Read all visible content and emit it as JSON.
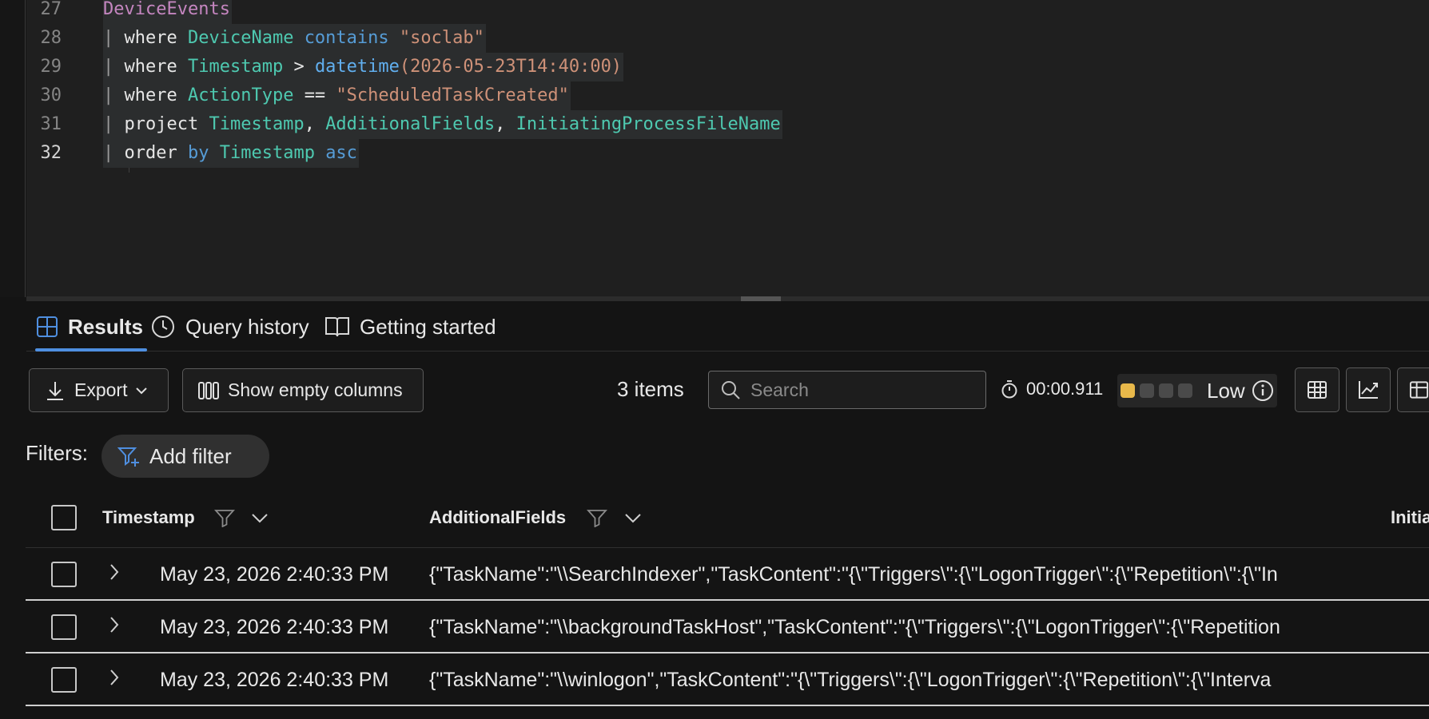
{
  "editor": {
    "lines": [
      {
        "num": "27",
        "tokens": [
          {
            "t": "DeviceEvents",
            "c": "k-purple"
          }
        ]
      },
      {
        "num": "28",
        "tokens": [
          {
            "t": "| ",
            "c": "bar"
          },
          {
            "t": "where ",
            "c": "k-white"
          },
          {
            "t": "DeviceName ",
            "c": "k-teal"
          },
          {
            "t": "contains ",
            "c": "k-blue"
          },
          {
            "t": "\"soclab\"",
            "c": "k-str"
          }
        ]
      },
      {
        "num": "29",
        "tokens": [
          {
            "t": "| ",
            "c": "bar"
          },
          {
            "t": "where ",
            "c": "k-white"
          },
          {
            "t": "Timestamp ",
            "c": "k-teal"
          },
          {
            "t": "> ",
            "c": "k-white"
          },
          {
            "t": "datetime",
            "c": "k-fn"
          },
          {
            "t": "(2026-05-23T14:40:00)",
            "c": "k-str"
          }
        ]
      },
      {
        "num": "30",
        "tokens": [
          {
            "t": "| ",
            "c": "bar"
          },
          {
            "t": "where ",
            "c": "k-white"
          },
          {
            "t": "ActionType ",
            "c": "k-teal"
          },
          {
            "t": "== ",
            "c": "k-white"
          },
          {
            "t": "\"ScheduledTaskCreated\"",
            "c": "k-str"
          }
        ]
      },
      {
        "num": "31",
        "tokens": [
          {
            "t": "| ",
            "c": "bar"
          },
          {
            "t": "project ",
            "c": "k-white"
          },
          {
            "t": "Timestamp",
            "c": "k-teal"
          },
          {
            "t": ", ",
            "c": "k-white"
          },
          {
            "t": "AdditionalFields",
            "c": "k-teal"
          },
          {
            "t": ", ",
            "c": "k-white"
          },
          {
            "t": "InitiatingProcessFileName",
            "c": "k-teal"
          }
        ]
      },
      {
        "num": "32",
        "tokens": [
          {
            "t": "| ",
            "c": "bar"
          },
          {
            "t": "order ",
            "c": "k-white"
          },
          {
            "t": "by ",
            "c": "k-blue"
          },
          {
            "t": "Timestamp ",
            "c": "k-teal"
          },
          {
            "t": "asc",
            "c": "k-blue"
          }
        ],
        "active": true
      }
    ]
  },
  "tabs": {
    "results": "Results",
    "query_history": "Query history",
    "getting_started": "Getting started"
  },
  "toolbar": {
    "export_label": "Export",
    "show_empty_columns_label": "Show empty columns",
    "items_count": "3 items",
    "search_placeholder": "Search",
    "elapsed_time": "00:00.911",
    "performance_label": "Low",
    "performance_level": 1,
    "performance_levels_total": 4,
    "performance_color": "#e8b84a"
  },
  "filters": {
    "label": "Filters:",
    "add_filter_label": "Add filter"
  },
  "table": {
    "columns": [
      "Timestamp",
      "AdditionalFields",
      "Initia"
    ],
    "rows": [
      {
        "timestamp": "May 23, 2026 2:40:33 PM",
        "additional_fields": "{\"TaskName\":\"\\\\SearchIndexer\",\"TaskContent\":\"{\\\"Triggers\\\":{\\\"LogonTrigger\\\":{\\\"Repetition\\\":{\\\"In"
      },
      {
        "timestamp": "May 23, 2026 2:40:33 PM",
        "additional_fields": "{\"TaskName\":\"\\\\backgroundTaskHost\",\"TaskContent\":\"{\\\"Triggers\\\":{\\\"LogonTrigger\\\":{\\\"Repetition"
      },
      {
        "timestamp": "May 23, 2026 2:40:33 PM",
        "additional_fields": "{\"TaskName\":\"\\\\winlogon\",\"TaskContent\":\"{\\\"Triggers\\\":{\\\"LogonTrigger\\\":{\\\"Repetition\\\":{\\\"Interva"
      }
    ]
  },
  "colors": {
    "accent": "#4f8fe0",
    "background": "#141414",
    "editor_background": "#1f1f1f"
  }
}
